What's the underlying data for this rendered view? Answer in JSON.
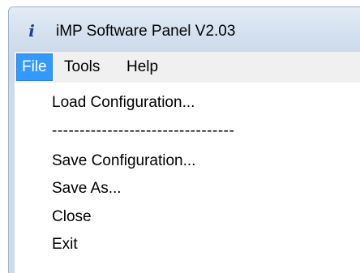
{
  "window": {
    "title": "iMP Software Panel V2.03",
    "app_icon": "info-i-icon"
  },
  "menubar": {
    "items": [
      {
        "label": "File",
        "active": true
      },
      {
        "label": "Tools",
        "active": false
      },
      {
        "label": "Help",
        "active": false
      }
    ]
  },
  "file_menu": {
    "load": "Load Configuration...",
    "separator": "---------------------------------",
    "save": "Save Configuration...",
    "save_as": "Save As...",
    "close": "Close",
    "exit": "Exit"
  },
  "colors": {
    "menu_highlight": "#3399ff",
    "titlebar": "#d6e2f0",
    "app_icon": "#1b3f9a"
  }
}
